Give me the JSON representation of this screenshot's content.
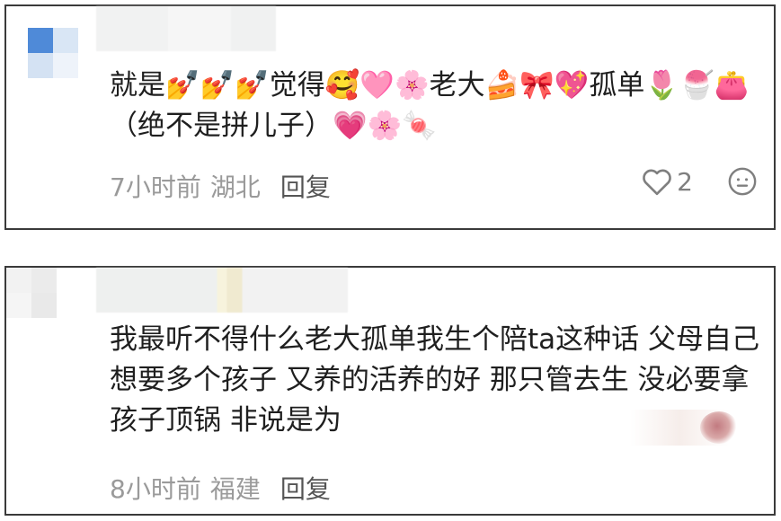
{
  "comments": [
    {
      "text": "就是💅💅💅觉得🥰🩷🌸老大🍰🎀💖孤单🌷🍧👛（绝不是拼儿子）💗🌸🍬",
      "time": "7小时前",
      "location": "湖北",
      "reply_label": "回复",
      "like_count": "2",
      "icons": {
        "like": "heart-outline-icon",
        "react": "neutral-face-icon"
      }
    },
    {
      "text": "我最听不得什么老大孤单我生个陪ta这种话 父母自己想要多个孩子 又养的活养的好 那只管去生 没必要拿孩子顶锅 非说是为",
      "time": "8小时前",
      "location": "福建",
      "reply_label": "回复"
    }
  ],
  "colors": {
    "border": "#3a3a3a",
    "meta_text": "#9a9a9a",
    "body_text": "#1f1f1f",
    "avatar_blue": "#4a86d6"
  }
}
